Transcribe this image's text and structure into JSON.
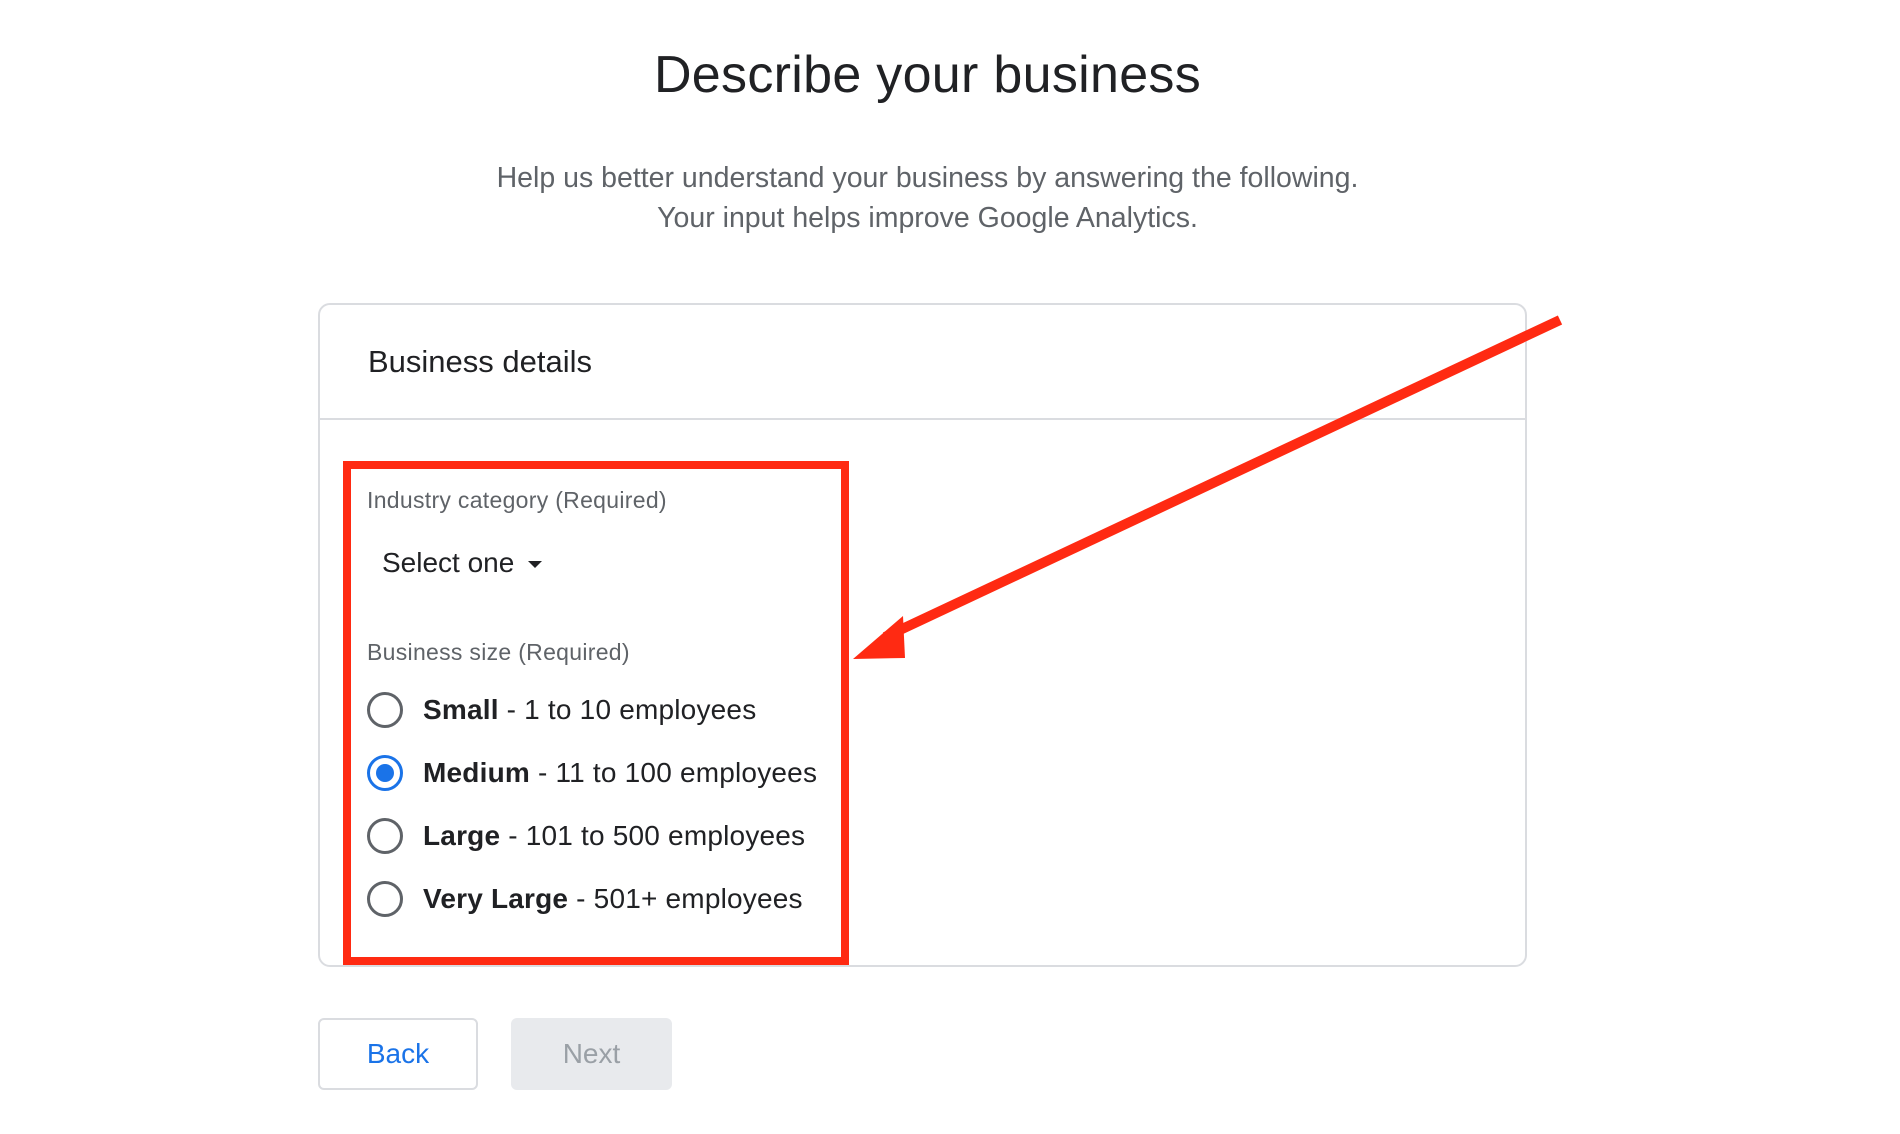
{
  "page": {
    "title": "Describe your business",
    "subtitle_line1": "Help us better understand your business by answering the following.",
    "subtitle_line2": "Your input helps improve Google Analytics."
  },
  "card": {
    "header": "Business details",
    "industry": {
      "label": "Industry category (Required)",
      "selected": "Select one"
    },
    "business_size": {
      "label": "Business size (Required)",
      "options": [
        {
          "name": "Small",
          "detail": " - 1 to 10 employees",
          "checked": false
        },
        {
          "name": "Medium",
          "detail": " - 11 to 100 employees",
          "checked": true
        },
        {
          "name": "Large",
          "detail": " - 101 to 500 employees",
          "checked": false
        },
        {
          "name": "Very Large",
          "detail": " - 501+ employees",
          "checked": false
        }
      ]
    }
  },
  "buttons": {
    "back_label": "Back",
    "next_label": "Next"
  },
  "annotation": {
    "color": "#ff2a12"
  },
  "colors": {
    "accent": "#1a73e8",
    "disabled_bg": "#e8eaed"
  }
}
